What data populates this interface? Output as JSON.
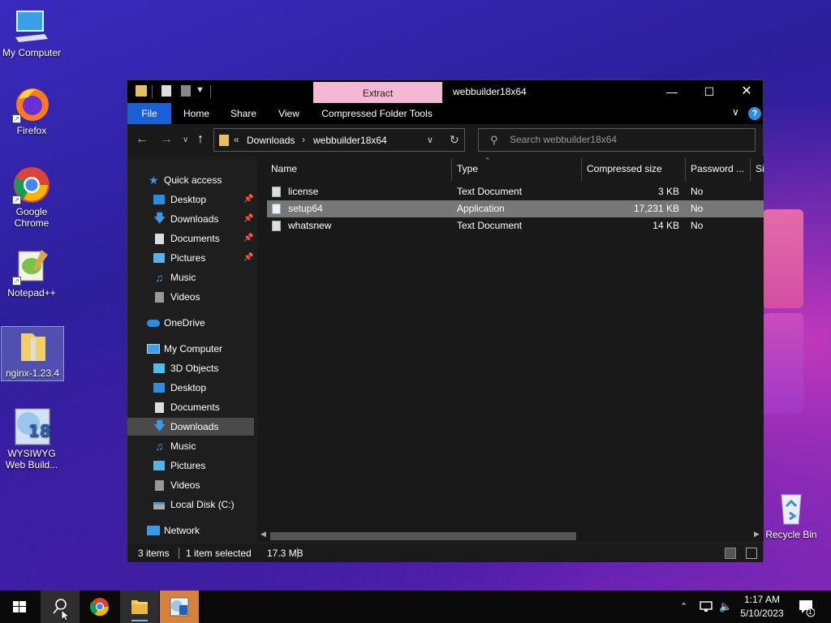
{
  "desktop": {
    "icons": [
      {
        "label": "My Computer"
      },
      {
        "label": "Firefox"
      },
      {
        "label": "Google Chrome"
      },
      {
        "label": "Notepad++"
      },
      {
        "label": "nginx-1.23.4"
      },
      {
        "label": "WYSIWYG Web Build..."
      },
      {
        "label": "Recycle Bin"
      }
    ]
  },
  "window": {
    "title": "webbuilder18x64",
    "context_tab": "Extract",
    "ribbon_tabs": [
      "File",
      "Home",
      "Share",
      "View",
      "Compressed Folder Tools"
    ],
    "help": "?",
    "address": {
      "overflow": "«",
      "crumbs": [
        "Downloads",
        "webbuilder18x64"
      ]
    },
    "search": {
      "placeholder": "Search webbuilder18x64"
    },
    "sidebar": [
      {
        "label": "Quick access"
      },
      {
        "label": "Desktop"
      },
      {
        "label": "Downloads"
      },
      {
        "label": "Documents"
      },
      {
        "label": "Pictures"
      },
      {
        "label": "Music"
      },
      {
        "label": "Videos"
      },
      {
        "label": "OneDrive"
      },
      {
        "label": "My Computer"
      },
      {
        "label": "3D Objects"
      },
      {
        "label": "Desktop"
      },
      {
        "label": "Documents"
      },
      {
        "label": "Downloads"
      },
      {
        "label": "Music"
      },
      {
        "label": "Pictures"
      },
      {
        "label": "Videos"
      },
      {
        "label": "Local Disk (C:)"
      },
      {
        "label": "Network"
      }
    ],
    "columns": [
      "Name",
      "Type",
      "Compressed size",
      "Password ...",
      "Siz"
    ],
    "files": [
      {
        "name": "license",
        "type": "Text Document",
        "size": "3 KB",
        "password": "No"
      },
      {
        "name": "setup64",
        "type": "Application",
        "size": "17,231 KB",
        "password": "No"
      },
      {
        "name": "whatsnew",
        "type": "Text Document",
        "size": "14 KB",
        "password": "No"
      }
    ],
    "status": {
      "items": "3 items",
      "selected": "1 item selected",
      "size": "17.3 MB"
    }
  },
  "taskbar": {
    "time": "1:17 AM",
    "date": "5/10/2023",
    "notifications": "1"
  },
  "colors": {
    "accent": "#1b5fd6",
    "extract_tab": "#f4b8d4",
    "folder": "#e8c060"
  }
}
